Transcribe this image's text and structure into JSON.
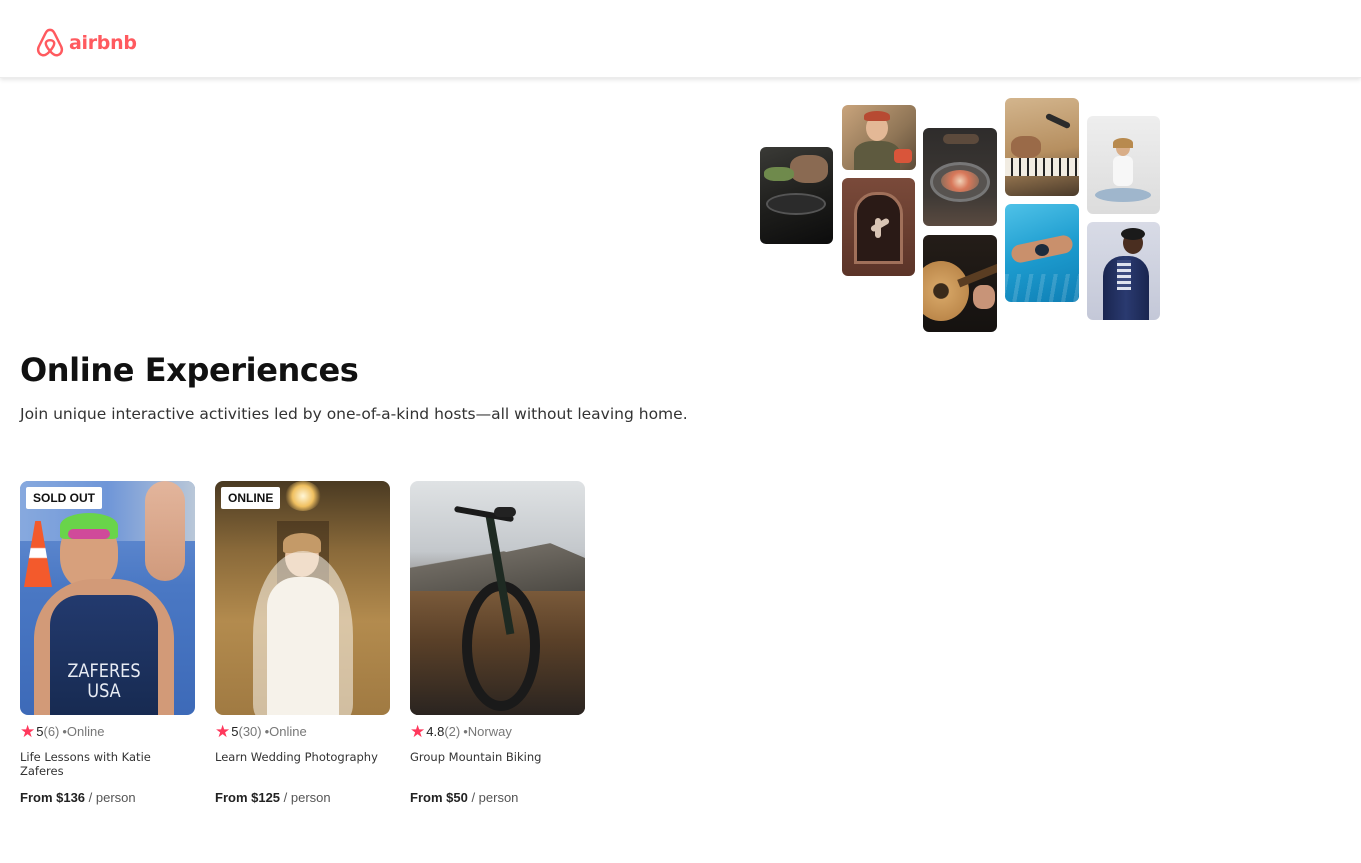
{
  "header": {
    "logo_text": "airbnb",
    "brand_color": "#FF5A5F"
  },
  "hero": {
    "title": "Online Experiences",
    "subtitle": "Join unique interactive activities led by one-of-a-kind hosts—all without leaving home."
  },
  "collage": [
    {
      "name": "cooking-photo"
    },
    {
      "name": "chef-woman-photo"
    },
    {
      "name": "dancer-doorway-photo"
    },
    {
      "name": "food-bowl-photo"
    },
    {
      "name": "guitar-photo"
    },
    {
      "name": "piano-mic-photo"
    },
    {
      "name": "swimmer-photo"
    },
    {
      "name": "yoga-photo"
    },
    {
      "name": "singer-photo"
    }
  ],
  "cards": [
    {
      "badge": "SOLD OUT",
      "rating": "5",
      "count": "(6)",
      "location": "•Online",
      "title": "Life Lessons with Katie Zaferes",
      "price": "From $136",
      "per": "/ person",
      "jersey_line1": "ZAFERES",
      "jersey_line2": "USA"
    },
    {
      "badge": "ONLINE",
      "rating": "5",
      "count": "(30)",
      "location": "•Online",
      "title": "Learn Wedding Photography",
      "price": "From $125",
      "per": "/ person"
    },
    {
      "badge": "",
      "rating": "4.8",
      "count": "(2)",
      "location": "•Norway",
      "title": "Group Mountain Biking",
      "price": "From $50",
      "per": "/ person"
    }
  ],
  "icons": {
    "logo": "airbnb-logo-icon",
    "star": "star-icon"
  }
}
